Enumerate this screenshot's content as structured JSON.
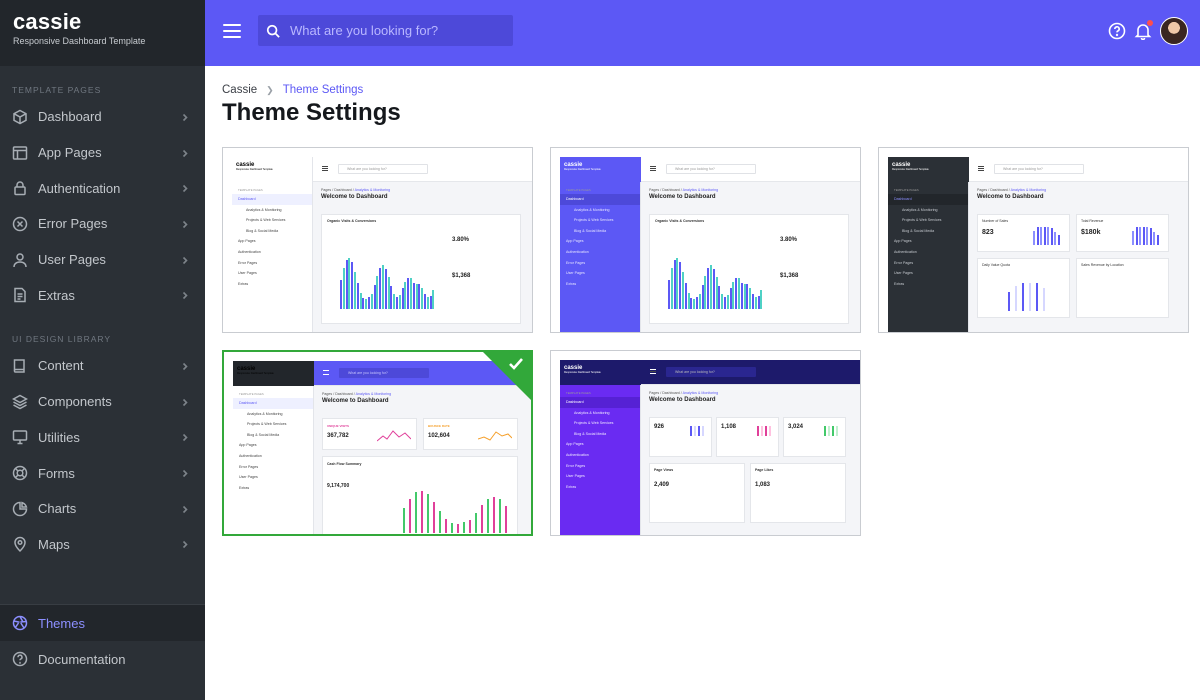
{
  "brand": {
    "name": "cassie",
    "tagline": "Responsive Dashboard Template"
  },
  "sidebar": {
    "section1": "TEMPLATE PAGES",
    "items1": [
      {
        "label": "Dashboard",
        "icon": "cube-icon"
      },
      {
        "label": "App Pages",
        "icon": "app-window-icon"
      },
      {
        "label": "Authentication",
        "icon": "lock-icon"
      },
      {
        "label": "Error Pages",
        "icon": "error-circle-icon"
      },
      {
        "label": "User Pages",
        "icon": "user-icon"
      },
      {
        "label": "Extras",
        "icon": "document-icon"
      }
    ],
    "section2": "UI DESIGN LIBRARY",
    "items2": [
      {
        "label": "Content",
        "icon": "book-icon"
      },
      {
        "label": "Components",
        "icon": "layers-icon"
      },
      {
        "label": "Utilities",
        "icon": "monitor-icon"
      },
      {
        "label": "Forms",
        "icon": "lifebuoy-icon"
      },
      {
        "label": "Charts",
        "icon": "pie-chart-icon"
      },
      {
        "label": "Maps",
        "icon": "map-pin-icon"
      }
    ],
    "bottom": [
      {
        "label": "Themes",
        "icon": "aperture-icon"
      },
      {
        "label": "Documentation",
        "icon": "help-circle-icon"
      }
    ]
  },
  "topbar": {
    "search_placeholder": "What are you looking for?"
  },
  "breadcrumb": {
    "root": "Cassie",
    "current": "Theme Settings"
  },
  "page": {
    "title": "Theme Settings"
  },
  "themes": {
    "selected_index": 3,
    "preview": {
      "logo": "cassie",
      "logo_tag": "Responsive Dashboard Template",
      "search": "What are you looking for?",
      "crumb_a": "Pages",
      "crumb_b": "Dashboard",
      "crumb_c": "Analytics & Monitoring",
      "welcome": "Welcome to Dashboard",
      "nav_section": "TEMPLATE PAGES",
      "nav": [
        "Dashboard",
        "Analytics & Monitoring",
        "Projects & Web Services",
        "Blog & Social Media",
        "App Pages",
        "Authentication",
        "Error Pages",
        "User Pages",
        "Extras"
      ],
      "chart_title": "Organic Visits & Conversions",
      "kpi_a": "3.80%",
      "kpi_b": "$1,368",
      "sales": "Number of Sales",
      "sales_val": "823",
      "revenue": "Total Revenue",
      "revenue_val": "$180k",
      "daily": "Daily Value Quota",
      "location": "Sales Revenue by Location",
      "unique": "UNIQUE VISITS",
      "unique_val": "367,782",
      "bounce": "BOUNCE RATE",
      "bounce_val": "102,604",
      "cashflow": "Cash Flow Summary",
      "cashflow_val": "9,174,700",
      "connections": "926",
      "articles": "1,108",
      "posts": "3,024",
      "pageviews": "Page Views",
      "pageviews_val": "2,409",
      "pagelikes": "Page Likes",
      "pagelikes_val": "1,083"
    }
  }
}
